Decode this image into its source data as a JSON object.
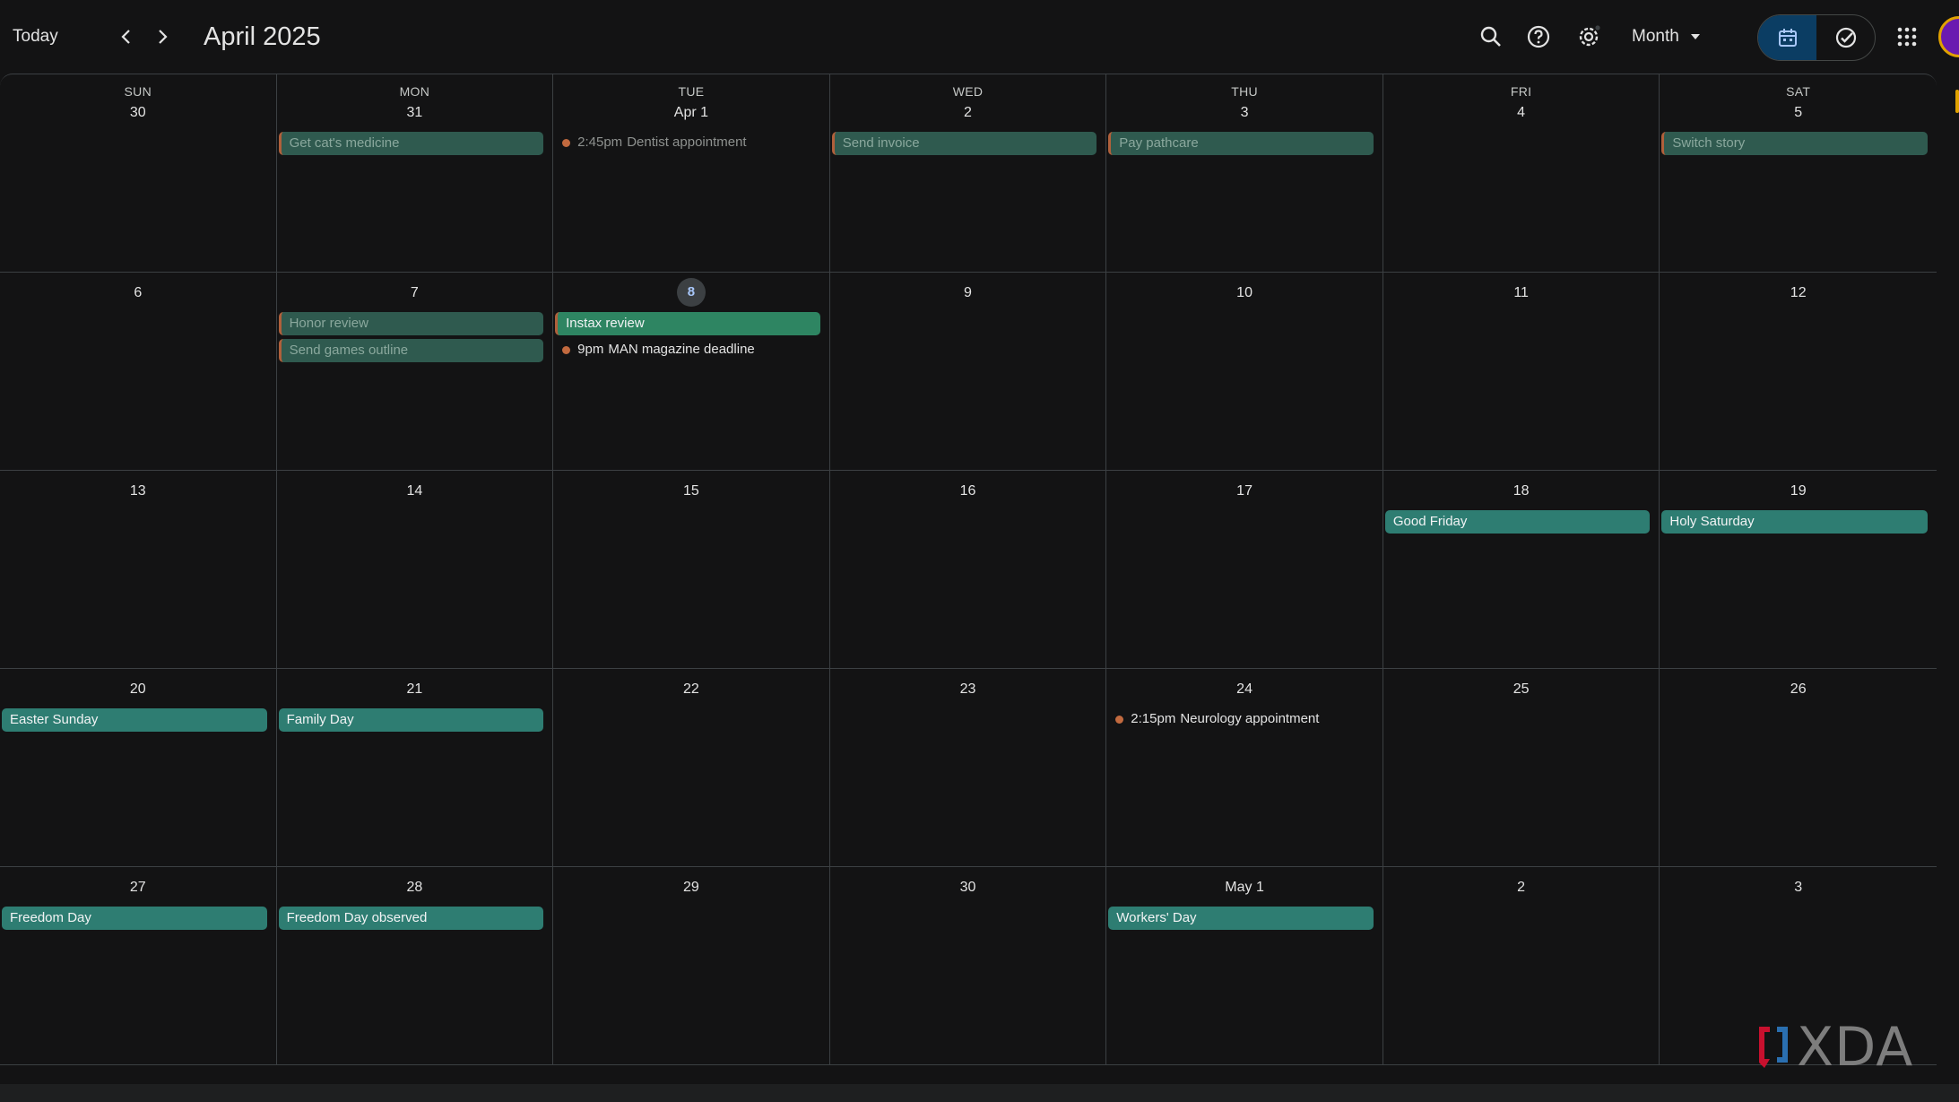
{
  "header": {
    "today_label": "Today",
    "month_title": "April 2025",
    "view_label": "Month"
  },
  "weekdays": [
    "SUN",
    "MON",
    "TUE",
    "WED",
    "THU",
    "FRI",
    "SAT"
  ],
  "weeks": [
    {
      "days": [
        {
          "label": "30",
          "events": []
        },
        {
          "label": "31",
          "events": [
            {
              "kind": "task",
              "title": "Get cat's medicine"
            }
          ]
        },
        {
          "label": "Apr 1",
          "events": [
            {
              "kind": "dot-past",
              "time": "2:45pm",
              "title": "Dentist appointment"
            }
          ]
        },
        {
          "label": "2",
          "events": [
            {
              "kind": "task",
              "title": "Send invoice"
            }
          ]
        },
        {
          "label": "3",
          "events": [
            {
              "kind": "task",
              "title": "Pay pathcare"
            }
          ]
        },
        {
          "label": "4",
          "events": []
        },
        {
          "label": "5",
          "events": [
            {
              "kind": "task",
              "title": "Switch story"
            }
          ]
        }
      ]
    },
    {
      "days": [
        {
          "label": "6",
          "events": []
        },
        {
          "label": "7",
          "events": [
            {
              "kind": "task",
              "title": "Honor review"
            },
            {
              "kind": "task",
              "title": "Send games outline"
            }
          ]
        },
        {
          "label": "8",
          "today": true,
          "events": [
            {
              "kind": "green",
              "title": "Instax review"
            },
            {
              "kind": "dot-upcoming",
              "time": "9pm",
              "title": "MAN magazine deadline"
            }
          ]
        },
        {
          "label": "9",
          "events": []
        },
        {
          "label": "10",
          "events": []
        },
        {
          "label": "11",
          "events": []
        },
        {
          "label": "12",
          "events": []
        }
      ]
    },
    {
      "days": [
        {
          "label": "13",
          "events": []
        },
        {
          "label": "14",
          "events": []
        },
        {
          "label": "15",
          "events": []
        },
        {
          "label": "16",
          "events": []
        },
        {
          "label": "17",
          "events": []
        },
        {
          "label": "18",
          "events": [
            {
              "kind": "holiday",
              "title": "Good Friday"
            }
          ]
        },
        {
          "label": "19",
          "events": [
            {
              "kind": "holiday",
              "title": "Holy Saturday"
            }
          ]
        }
      ]
    },
    {
      "days": [
        {
          "label": "20",
          "events": [
            {
              "kind": "holiday",
              "title": "Easter Sunday"
            }
          ]
        },
        {
          "label": "21",
          "events": [
            {
              "kind": "holiday",
              "title": "Family Day"
            }
          ]
        },
        {
          "label": "22",
          "events": []
        },
        {
          "label": "23",
          "events": []
        },
        {
          "label": "24",
          "events": [
            {
              "kind": "dot-upcoming",
              "time": "2:15pm",
              "title": "Neurology appointment"
            }
          ]
        },
        {
          "label": "25",
          "events": []
        },
        {
          "label": "26",
          "events": []
        }
      ]
    },
    {
      "days": [
        {
          "label": "27",
          "events": [
            {
              "kind": "holiday",
              "title": "Freedom Day"
            }
          ]
        },
        {
          "label": "28",
          "events": [
            {
              "kind": "holiday",
              "title": "Freedom Day observed"
            }
          ]
        },
        {
          "label": "29",
          "events": []
        },
        {
          "label": "30",
          "events": []
        },
        {
          "label": "May 1",
          "events": [
            {
              "kind": "holiday",
              "title": "Workers' Day"
            }
          ]
        },
        {
          "label": "2",
          "events": []
        },
        {
          "label": "3",
          "events": []
        }
      ]
    }
  ],
  "watermark": {
    "text": "XDA"
  },
  "colors": {
    "background": "#131314",
    "holiday": "#2e7d72",
    "task": "#2f5a4f",
    "event_green": "#2e8562",
    "dot": "#c26a3f",
    "today_accent": "#a8c7fa",
    "avatar": "#6a1ab0"
  }
}
